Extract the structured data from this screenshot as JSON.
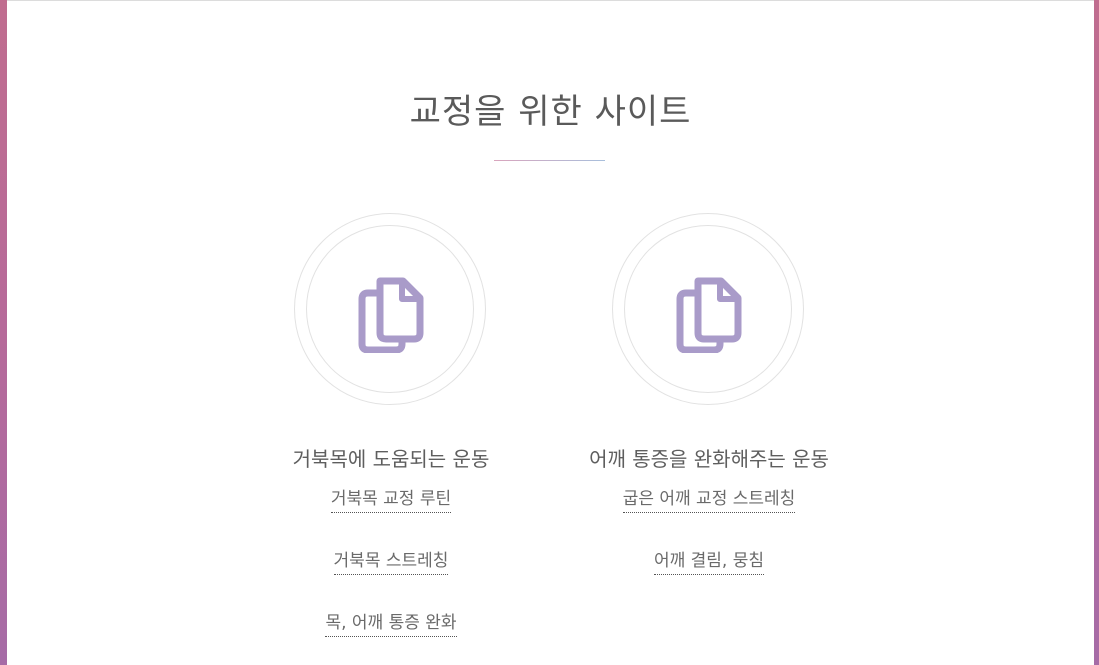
{
  "title": "교정을 위한 사이트",
  "colors": {
    "icon": "#a99bc9",
    "text": "#5e5e5e",
    "frame_left": "#c06d8f",
    "frame_right": "#a66ba6"
  },
  "columns": [
    {
      "icon": "copy-icon",
      "heading": "거북목에 도움되는 운동",
      "links": [
        "거북목 교정 루틴",
        "거북목 스트레칭",
        "목, 어깨 통증 완화"
      ]
    },
    {
      "icon": "copy-icon",
      "heading": "어깨 통증을 완화해주는 운동",
      "links": [
        "굽은 어깨 교정 스트레칭",
        "어깨 결림, 뭉침"
      ]
    }
  ]
}
